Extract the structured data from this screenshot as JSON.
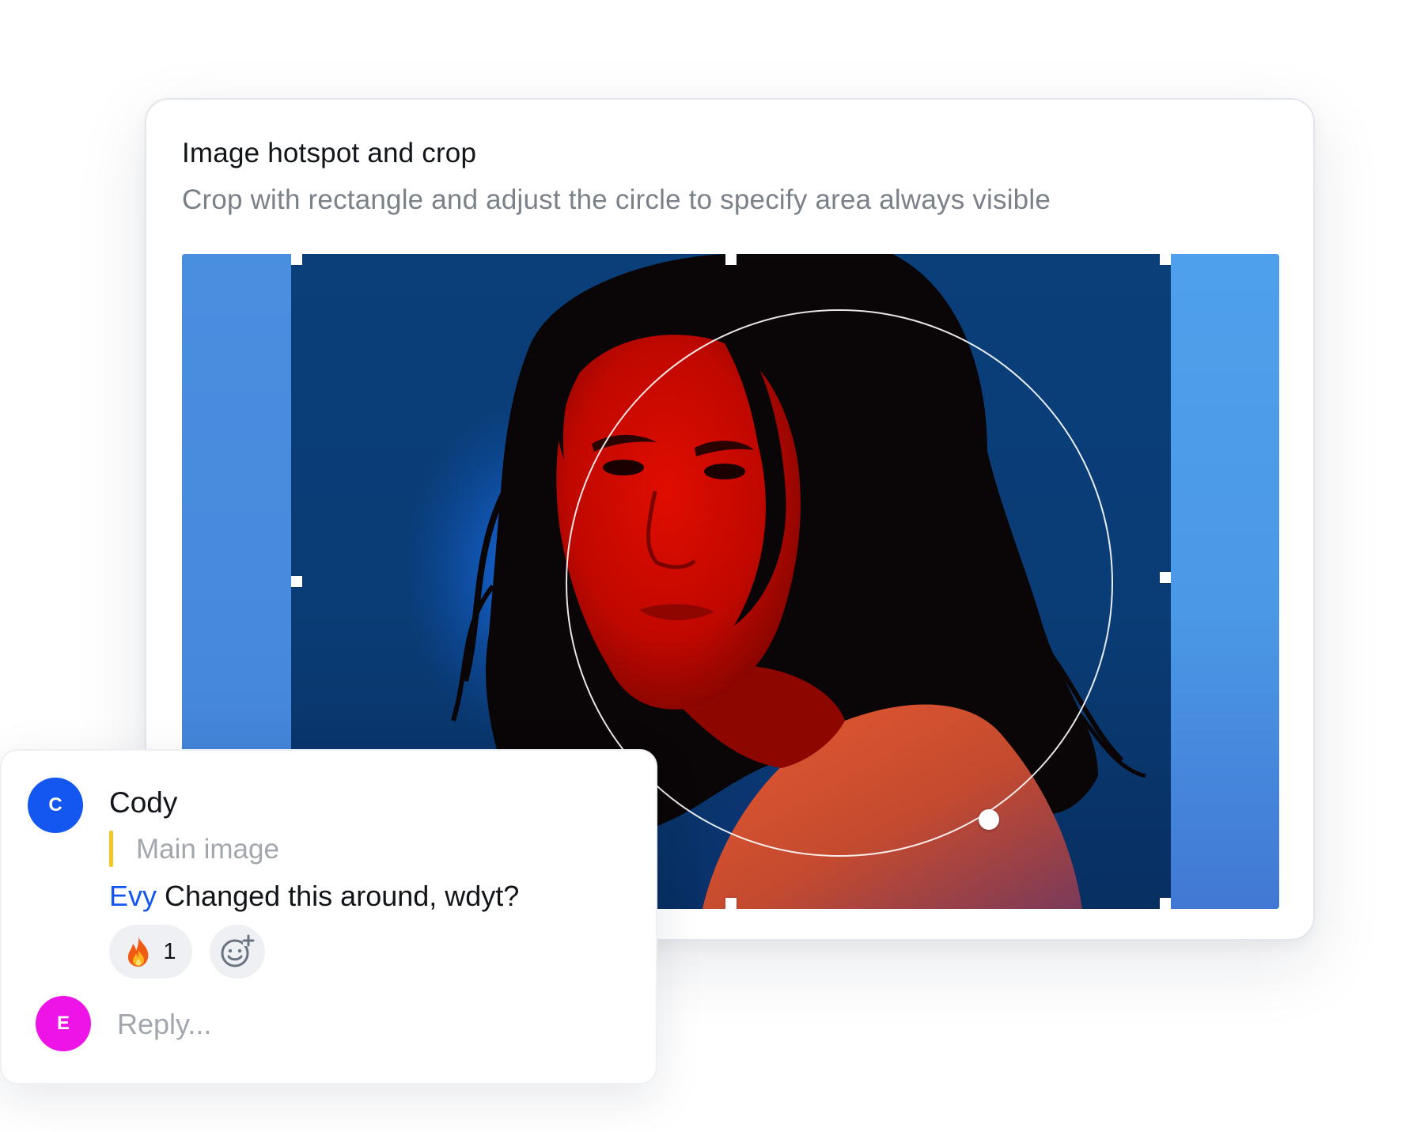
{
  "card": {
    "title": "Image hotspot and crop",
    "subtitle": "Crop with rectangle and adjust the circle to specify area always visible"
  },
  "editor": {
    "colors": {
      "outside_left": "#4a8ee0",
      "outside_right": "#4fa0ec",
      "background": "#0a3f7a",
      "face": "#d40a00",
      "shirt": "#e0502e",
      "hair": "#0a0506"
    },
    "icons": {
      "crop_handle": "square-handle",
      "hotspot_resize": "circle-handle"
    }
  },
  "comment": {
    "author": "Cody",
    "author_initial": "C",
    "author_color": "#1357f0",
    "quote": "Main image",
    "quote_bar_color": "#f3c623",
    "mention": "Evy",
    "mention_color": "#1357f0",
    "message": "Changed this around, wdyt?",
    "reaction": {
      "emoji_icon": "fire-icon",
      "count": "1"
    },
    "add_reaction_icon": "add-emoji-icon",
    "reply": {
      "placeholder": "Reply...",
      "user_initial": "E",
      "user_color": "#ee13e6"
    }
  }
}
